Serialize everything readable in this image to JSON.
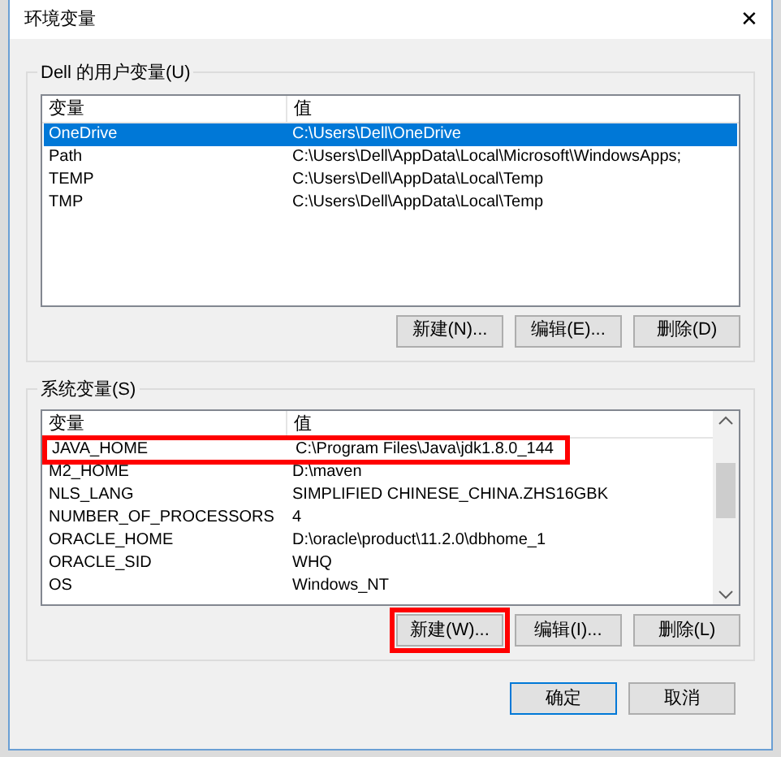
{
  "window": {
    "title": "环境变量",
    "close": "✕"
  },
  "user_vars": {
    "legend": "Dell 的用户变量(U)",
    "columns": [
      "变量",
      "值"
    ],
    "rows": [
      {
        "name": "OneDrive",
        "value": "C:\\Users\\Dell\\OneDrive",
        "selected": true,
        "highlighted": false
      },
      {
        "name": "Path",
        "value": "C:\\Users\\Dell\\AppData\\Local\\Microsoft\\WindowsApps;",
        "selected": false,
        "highlighted": false
      },
      {
        "name": "TEMP",
        "value": "C:\\Users\\Dell\\AppData\\Local\\Temp",
        "selected": false,
        "highlighted": false
      },
      {
        "name": "TMP",
        "value": "C:\\Users\\Dell\\AppData\\Local\\Temp",
        "selected": false,
        "highlighted": false
      }
    ],
    "buttons": [
      {
        "label": "新建(N)...",
        "highlighted": false
      },
      {
        "label": "编辑(E)...",
        "highlighted": false
      },
      {
        "label": "删除(D)",
        "highlighted": false
      }
    ]
  },
  "system_vars": {
    "legend": "系统变量(S)",
    "columns": [
      "变量",
      "值"
    ],
    "rows": [
      {
        "name": "JAVA_HOME",
        "value": "C:\\Program Files\\Java\\jdk1.8.0_144",
        "selected": false,
        "highlighted": true
      },
      {
        "name": "M2_HOME",
        "value": "D:\\maven",
        "selected": false,
        "highlighted": false
      },
      {
        "name": "NLS_LANG",
        "value": "SIMPLIFIED CHINESE_CHINA.ZHS16GBK",
        "selected": false,
        "highlighted": false
      },
      {
        "name": "NUMBER_OF_PROCESSORS",
        "value": "4",
        "selected": false,
        "highlighted": false
      },
      {
        "name": "ORACLE_HOME",
        "value": "D:\\oracle\\product\\11.2.0\\dbhome_1",
        "selected": false,
        "highlighted": false
      },
      {
        "name": "ORACLE_SID",
        "value": "WHQ",
        "selected": false,
        "highlighted": false
      },
      {
        "name": "OS",
        "value": "Windows_NT",
        "selected": false,
        "highlighted": false
      }
    ],
    "buttons": [
      {
        "label": "新建(W)...",
        "highlighted": true
      },
      {
        "label": "编辑(I)...",
        "highlighted": false
      },
      {
        "label": "删除(L)",
        "highlighted": false
      }
    ]
  },
  "footer_buttons": [
    {
      "label": "确定",
      "default": true
    },
    {
      "label": "取消",
      "default": false
    }
  ]
}
